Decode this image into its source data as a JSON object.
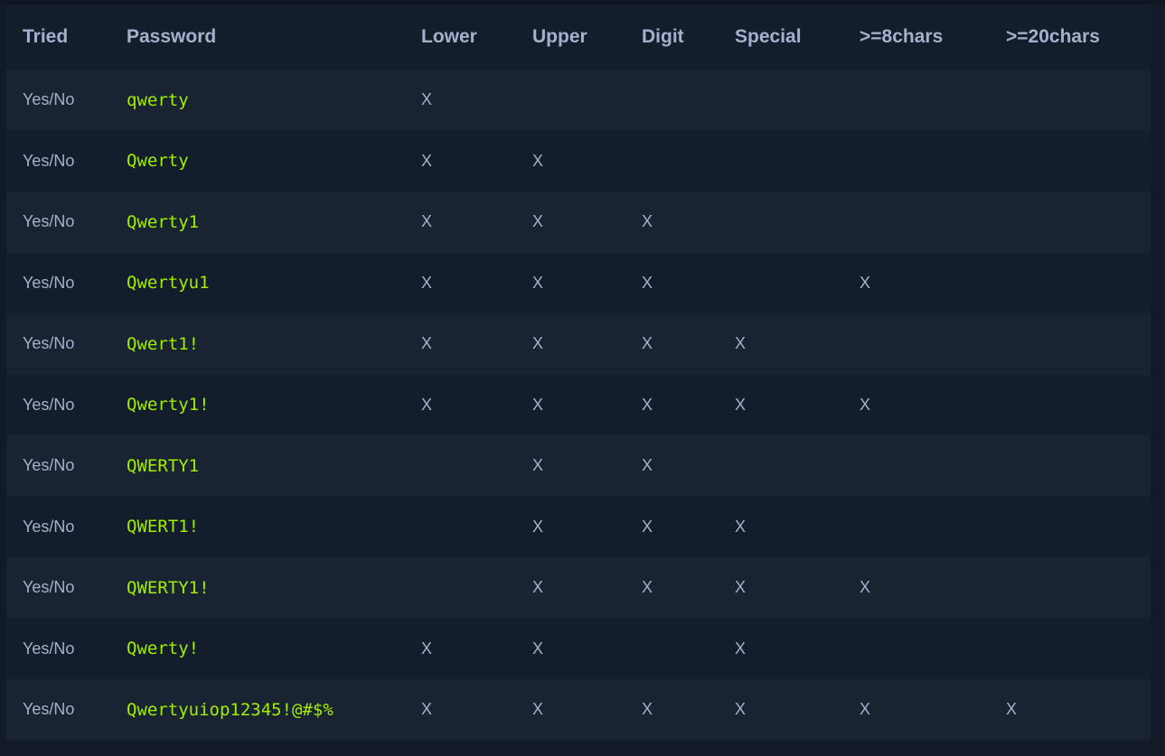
{
  "columns": [
    "Tried",
    "Password",
    "Lower",
    "Upper",
    "Digit",
    "Special",
    ">=8chars",
    ">=20chars"
  ],
  "rows": [
    {
      "tried": "Yes/No",
      "password": "qwerty",
      "lower": "X",
      "upper": "",
      "digit": "",
      "special": "",
      "len8": "",
      "len20": ""
    },
    {
      "tried": "Yes/No",
      "password": "Qwerty",
      "lower": "X",
      "upper": "X",
      "digit": "",
      "special": "",
      "len8": "",
      "len20": ""
    },
    {
      "tried": "Yes/No",
      "password": "Qwerty1",
      "lower": "X",
      "upper": "X",
      "digit": "X",
      "special": "",
      "len8": "",
      "len20": ""
    },
    {
      "tried": "Yes/No",
      "password": "Qwertyu1",
      "lower": "X",
      "upper": "X",
      "digit": "X",
      "special": "",
      "len8": "X",
      "len20": ""
    },
    {
      "tried": "Yes/No",
      "password": "Qwert1!",
      "lower": "X",
      "upper": "X",
      "digit": "X",
      "special": "X",
      "len8": "",
      "len20": ""
    },
    {
      "tried": "Yes/No",
      "password": "Qwerty1!",
      "lower": "X",
      "upper": "X",
      "digit": "X",
      "special": "X",
      "len8": "X",
      "len20": ""
    },
    {
      "tried": "Yes/No",
      "password": "QWERTY1",
      "lower": "",
      "upper": "X",
      "digit": "X",
      "special": "",
      "len8": "",
      "len20": ""
    },
    {
      "tried": "Yes/No",
      "password": "QWERT1!",
      "lower": "",
      "upper": "X",
      "digit": "X",
      "special": "X",
      "len8": "",
      "len20": ""
    },
    {
      "tried": "Yes/No",
      "password": "QWERTY1!",
      "lower": "",
      "upper": "X",
      "digit": "X",
      "special": "X",
      "len8": "X",
      "len20": ""
    },
    {
      "tried": "Yes/No",
      "password": "Qwerty!",
      "lower": "X",
      "upper": "X",
      "digit": "",
      "special": "X",
      "len8": "",
      "len20": ""
    },
    {
      "tried": "Yes/No",
      "password": "Qwertyuiop12345!@#$%",
      "lower": "X",
      "upper": "X",
      "digit": "X",
      "special": "X",
      "len8": "X",
      "len20": "X"
    }
  ],
  "colors": {
    "background": "#121a27",
    "row_alt": "#1a2332",
    "header_text": "#a4b1cd",
    "password_text": "#9fef00"
  }
}
